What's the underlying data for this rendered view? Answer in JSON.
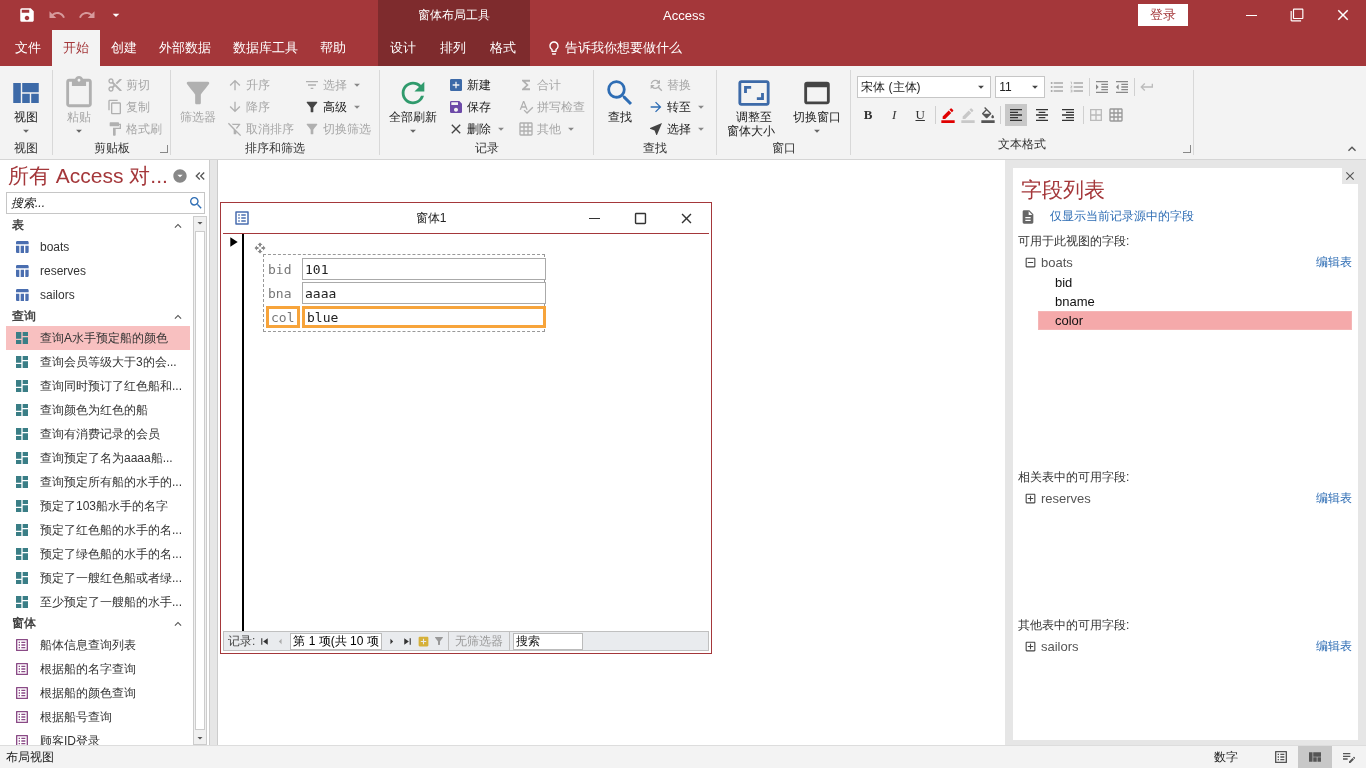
{
  "app": {
    "title": "Access",
    "context_group": "窗体布局工具",
    "sign_in": "登录"
  },
  "tabs": [
    {
      "label": "文件",
      "selected": false,
      "contextual": false
    },
    {
      "label": "开始",
      "selected": true,
      "contextual": false
    },
    {
      "label": "创建",
      "selected": false,
      "contextual": false
    },
    {
      "label": "外部数据",
      "selected": false,
      "contextual": false
    },
    {
      "label": "数据库工具",
      "selected": false,
      "contextual": false
    },
    {
      "label": "帮助",
      "selected": false,
      "contextual": false
    },
    {
      "label": "设计",
      "selected": false,
      "contextual": true
    },
    {
      "label": "排列",
      "selected": false,
      "contextual": true
    },
    {
      "label": "格式",
      "selected": false,
      "contextual": true
    }
  ],
  "tell_me": "告诉我你想要做什么",
  "ribbon": {
    "groups": [
      {
        "title": "视图",
        "kind": "buttons",
        "launcher": false,
        "columns": [
          [
            {
              "kind": "large",
              "label": "视图",
              "dropdown": true,
              "disabled": false
            }
          ]
        ]
      },
      {
        "title": "剪贴板",
        "kind": "buttons",
        "launcher": true,
        "columns": [
          [
            {
              "kind": "large",
              "label": "粘贴",
              "dropdown": true,
              "disabled": true
            }
          ],
          [
            {
              "kind": "small",
              "label": "剪切",
              "dropdown": false,
              "disabled": true
            },
            {
              "kind": "small",
              "label": "复制",
              "dropdown": false,
              "disabled": true
            },
            {
              "kind": "small",
              "label": "格式刷",
              "dropdown": false,
              "disabled": true
            }
          ]
        ]
      },
      {
        "title": "排序和筛选",
        "kind": "buttons",
        "launcher": false,
        "columns": [
          [
            {
              "kind": "large",
              "label": "筛选器",
              "dropdown": false,
              "disabled": true
            }
          ],
          [
            {
              "kind": "small",
              "label": "升序",
              "dropdown": false,
              "disabled": true
            },
            {
              "kind": "small",
              "label": "降序",
              "dropdown": false,
              "disabled": true
            },
            {
              "kind": "small",
              "label": "取消排序",
              "dropdown": false,
              "disabled": true
            }
          ],
          [
            {
              "kind": "small",
              "label": "选择",
              "dropdown": true,
              "disabled": true
            },
            {
              "kind": "small",
              "label": "高级",
              "dropdown": true,
              "disabled": false
            },
            {
              "kind": "small",
              "label": "切换筛选",
              "dropdown": false,
              "disabled": true
            }
          ]
        ]
      },
      {
        "title": "记录",
        "kind": "buttons",
        "launcher": false,
        "columns": [
          [
            {
              "kind": "large",
              "label": "全部刷新",
              "dropdown": true,
              "disabled": false
            }
          ],
          [
            {
              "kind": "small",
              "label": "新建",
              "dropdown": false,
              "disabled": false
            },
            {
              "kind": "small",
              "label": "保存",
              "dropdown": false,
              "disabled": false
            },
            {
              "kind": "small",
              "label": "删除",
              "dropdown": true,
              "disabled": false
            }
          ],
          [
            {
              "kind": "small",
              "label": "合计",
              "dropdown": false,
              "disabled": true
            },
            {
              "kind": "small",
              "label": "拼写检查",
              "dropdown": false,
              "disabled": true
            },
            {
              "kind": "small",
              "label": "其他",
              "dropdown": true,
              "disabled": true
            }
          ]
        ]
      },
      {
        "title": "查找",
        "kind": "buttons",
        "launcher": false,
        "columns": [
          [
            {
              "kind": "large",
              "label": "查找",
              "dropdown": false,
              "disabled": false
            }
          ],
          [
            {
              "kind": "small",
              "label": "替换",
              "dropdown": false,
              "disabled": true
            },
            {
              "kind": "small",
              "label": "转至",
              "dropdown": true,
              "disabled": false
            },
            {
              "kind": "small",
              "label": "选择",
              "dropdown": true,
              "disabled": false
            }
          ]
        ]
      },
      {
        "title": "窗口",
        "kind": "buttons",
        "launcher": false,
        "columns": [
          [
            {
              "kind": "large",
              "label": "调整至窗体大小",
              "dropdown": false,
              "disabled": false
            }
          ],
          [
            {
              "kind": "large",
              "label": "切换窗口",
              "dropdown": true,
              "disabled": false
            }
          ]
        ]
      },
      {
        "title": "文本格式",
        "kind": "text_format",
        "launcher": true,
        "font": "宋体 (主体)",
        "size": "11",
        "styles": [
          "B",
          "I",
          "U"
        ],
        "align": [
          {
            "selected": true
          },
          {
            "selected": false
          },
          {
            "selected": false
          }
        ]
      }
    ]
  },
  "nav": {
    "title": "所有 Access 对...",
    "search_placeholder": "搜索...",
    "sections": [
      {
        "title": "表",
        "kind": "table",
        "items": [
          {
            "label": "boats",
            "selected": false
          },
          {
            "label": "reserves",
            "selected": false
          },
          {
            "label": "sailors",
            "selected": false
          }
        ]
      },
      {
        "title": "查询",
        "kind": "query",
        "items": [
          {
            "label": "查询A水手预定船的颜色",
            "selected": true
          },
          {
            "label": "查询会员等级大于3的会...",
            "selected": false
          },
          {
            "label": "查询同时预订了红色船和...",
            "selected": false
          },
          {
            "label": "查询颜色为红色的船",
            "selected": false
          },
          {
            "label": "查询有消费记录的会员",
            "selected": false
          },
          {
            "label": "查询预定了名为aaaa船...",
            "selected": false
          },
          {
            "label": "查询预定所有船的水手的...",
            "selected": false
          },
          {
            "label": "预定了103船水手的名字",
            "selected": false
          },
          {
            "label": "预定了红色船的水手的名...",
            "selected": false
          },
          {
            "label": "预定了绿色船的水手的名...",
            "selected": false
          },
          {
            "label": "预定了一艘红色船或者绿...",
            "selected": false
          },
          {
            "label": "至少预定了一艘船的水手...",
            "selected": false
          }
        ]
      },
      {
        "title": "窗体",
        "kind": "form",
        "items": [
          {
            "label": "船体信息查询列表",
            "selected": false
          },
          {
            "label": "根据船的名字查询",
            "selected": false
          },
          {
            "label": "根据船的颜色查询",
            "selected": false
          },
          {
            "label": "根据船号查询",
            "selected": false
          },
          {
            "label": "顾客ID登录",
            "selected": false
          }
        ]
      }
    ]
  },
  "form": {
    "title": "窗体1",
    "fields": [
      {
        "label": "bid",
        "value": "101",
        "selected": false
      },
      {
        "label": "bna",
        "value": "aaaa",
        "selected": false
      },
      {
        "label": "col",
        "value": "blue",
        "selected": true
      }
    ],
    "record_nav": {
      "label": "记录:",
      "position": "第 1 项(共 10 项",
      "filter": "无筛选器",
      "search_placeholder": "搜索"
    }
  },
  "field_list": {
    "title": "字段列表",
    "option": "仅显示当前记录源中的字段",
    "sections": [
      {
        "heading": "可用于此视图的字段:",
        "tables": [
          {
            "name": "boats",
            "expanded": true,
            "edit": "编辑表",
            "fields": [
              {
                "name": "bid",
                "selected": false
              },
              {
                "name": "bname",
                "selected": false
              },
              {
                "name": "color",
                "selected": true
              }
            ]
          }
        ]
      },
      {
        "heading": "相关表中的可用字段:",
        "tables": [
          {
            "name": "reserves",
            "expanded": false,
            "edit": "编辑表"
          }
        ]
      },
      {
        "heading": "其他表中的可用字段:",
        "tables": [
          {
            "name": "sailors",
            "expanded": false,
            "edit": "编辑表"
          }
        ]
      }
    ]
  },
  "status": {
    "text": "布局视图",
    "num_lock": "数字",
    "views": [
      {
        "selected": false
      },
      {
        "selected": true
      },
      {
        "selected": false
      }
    ]
  }
}
